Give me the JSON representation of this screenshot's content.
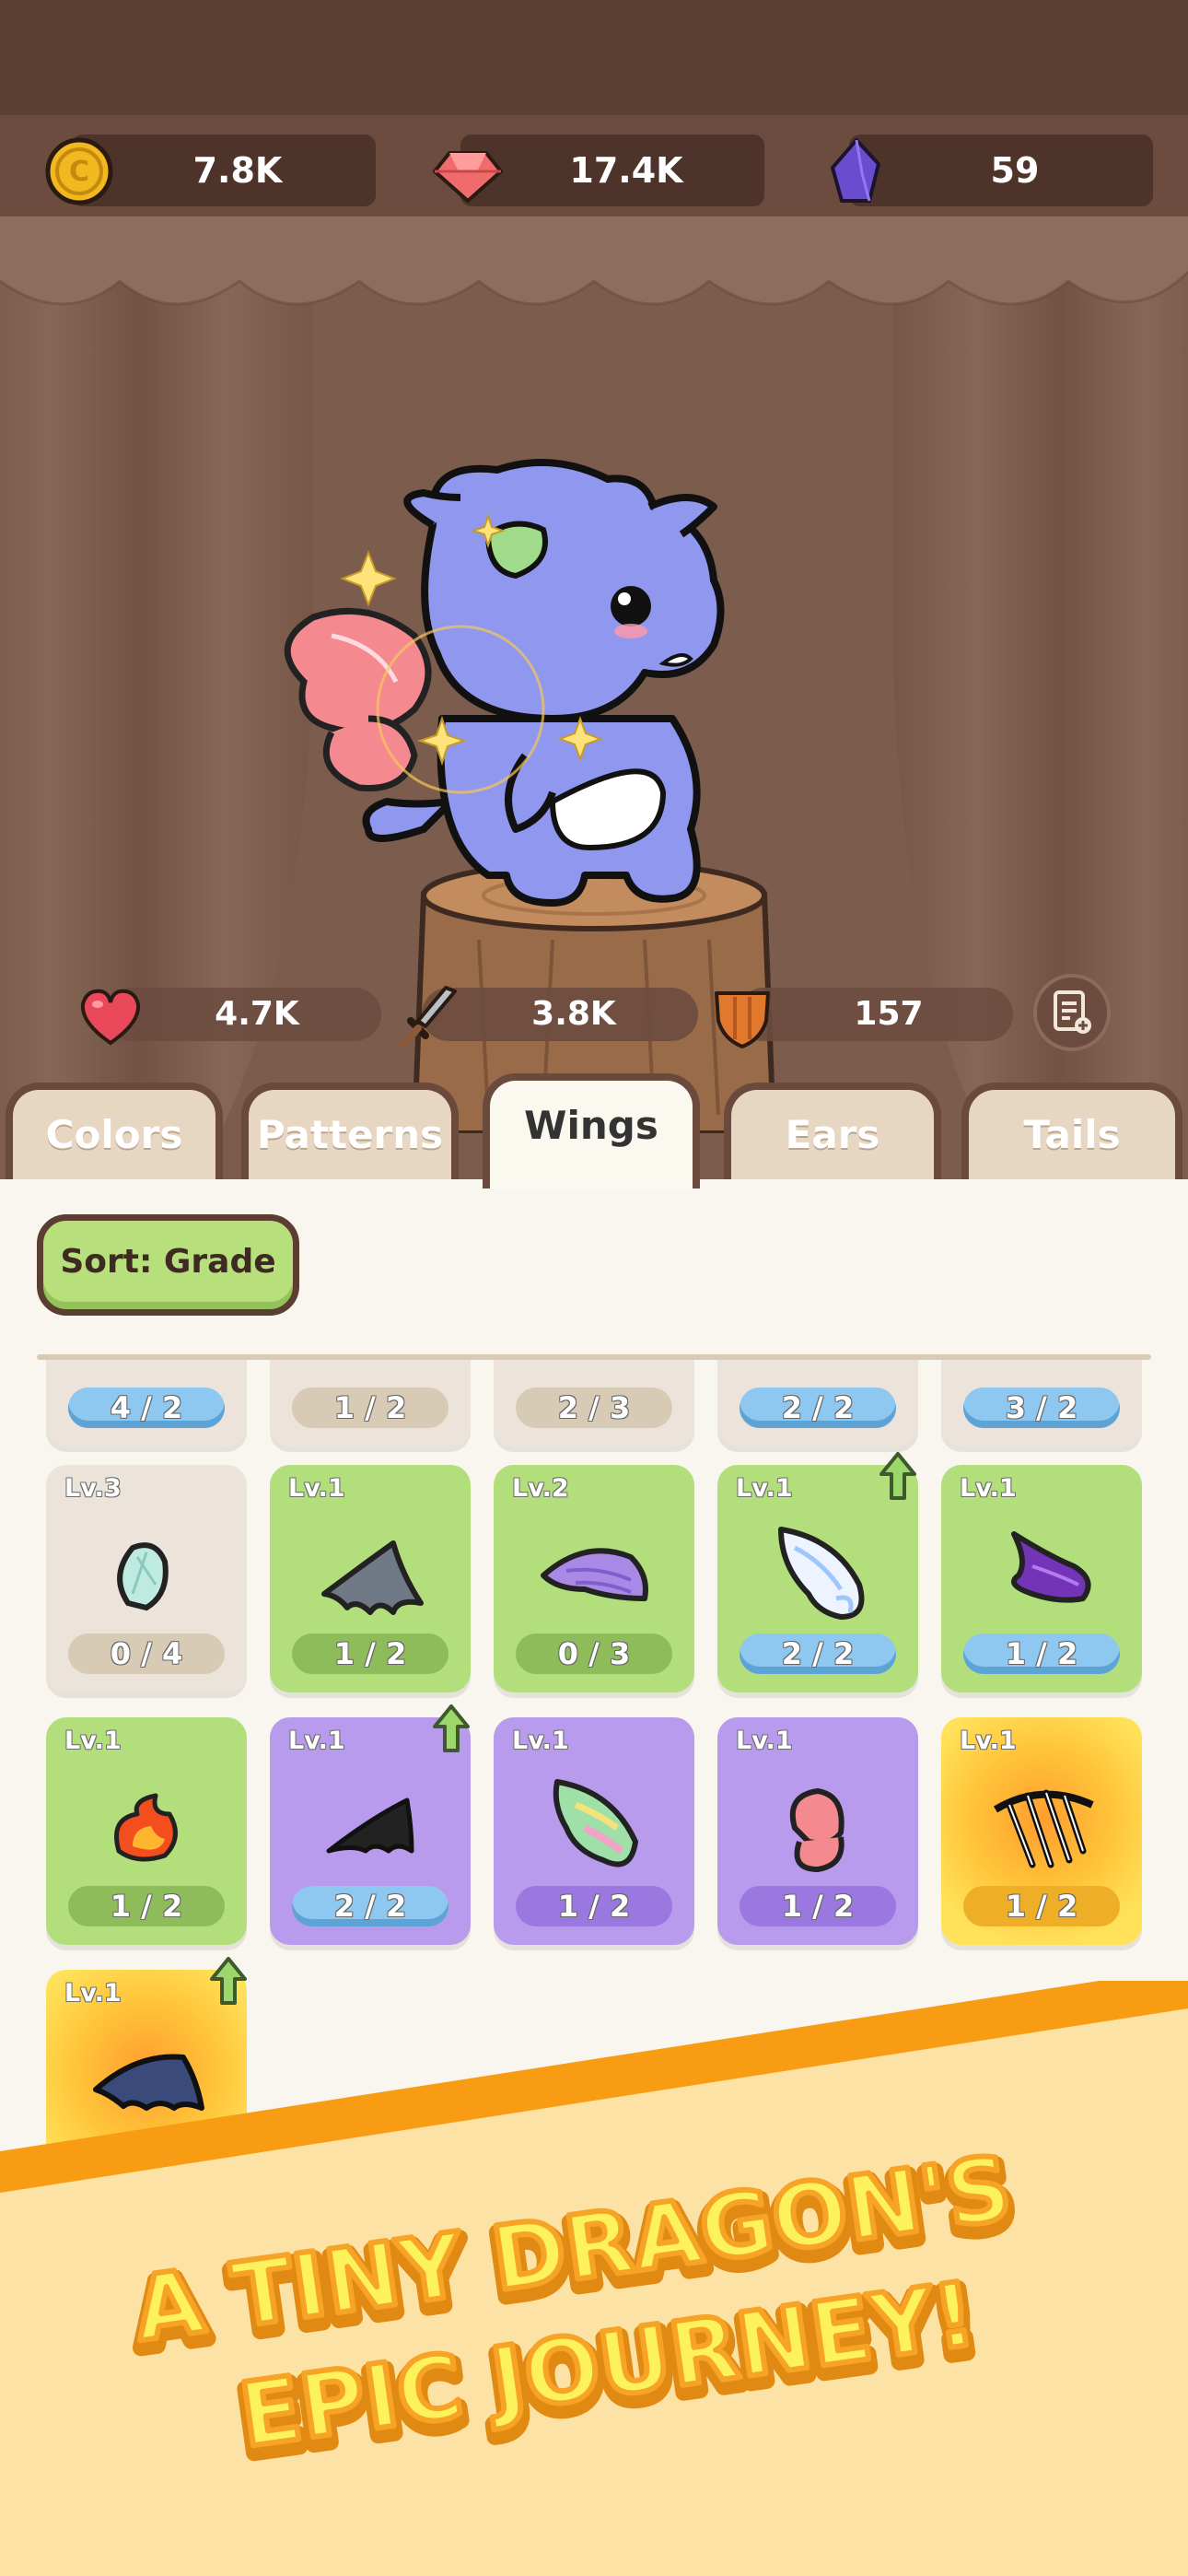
{
  "currency": {
    "coins": "7.8K",
    "gems": "17.4K",
    "crystals": "59"
  },
  "stats": {
    "health": "4.7K",
    "attack": "3.8K",
    "defense": "157"
  },
  "tabs": [
    "Colors",
    "Patterns",
    "Wings",
    "Ears",
    "Tails"
  ],
  "active_tab": "Wings",
  "sort_label": "Sort: Grade",
  "partial_row": [
    {
      "count": "4 / 2",
      "style": "full"
    },
    {
      "count": "1 / 2",
      "style": "tan"
    },
    {
      "count": "2 / 3",
      "style": "tan"
    },
    {
      "count": "2 / 2",
      "style": "full"
    },
    {
      "count": "3 / 2",
      "style": "full"
    }
  ],
  "items": [
    {
      "level": "Lv.3",
      "count": "0 / 4",
      "rarity": "gray",
      "icon": "egg-shell-wing-icon",
      "upgrade": false
    },
    {
      "level": "Lv.1",
      "count": "1 / 2",
      "rarity": "green",
      "icon": "gray-bat-wing-icon",
      "upgrade": false
    },
    {
      "level": "Lv.2",
      "count": "0 / 3",
      "rarity": "green",
      "icon": "purple-feather-wing-icon",
      "upgrade": false
    },
    {
      "level": "Lv.1",
      "count": "2 / 2",
      "rarity": "green",
      "icon": "angel-wing-icon",
      "upgrade": true
    },
    {
      "level": "Lv.1",
      "count": "1 / 2",
      "rarity": "green",
      "icon": "dark-purple-wing-icon",
      "upgrade": false
    },
    {
      "level": "Lv.1",
      "count": "1 / 2",
      "rarity": "green",
      "icon": "fire-wing-icon",
      "upgrade": false
    },
    {
      "level": "Lv.1",
      "count": "2 / 2",
      "rarity": "purple",
      "icon": "black-bat-wing-icon",
      "upgrade": true
    },
    {
      "level": "Lv.1",
      "count": "1 / 2",
      "rarity": "purple",
      "icon": "rainbow-wing-icon",
      "upgrade": false
    },
    {
      "level": "Lv.1",
      "count": "1 / 2",
      "rarity": "purple",
      "icon": "pink-butterfly-wing-icon",
      "upgrade": false
    },
    {
      "level": "Lv.1",
      "count": "1 / 2",
      "rarity": "yellow",
      "icon": "skeleton-wing-icon",
      "upgrade": false
    },
    {
      "level": "Lv.1",
      "count": "",
      "rarity": "yellow",
      "icon": "demon-bat-wing-icon",
      "upgrade": true
    }
  ],
  "banner": {
    "line1": "A TINY DRAGON'S",
    "line2": "EPIC JOURNEY!"
  },
  "colors": {
    "accent_green": "#b2df7b",
    "rare_purple": "#b99bee",
    "legend_yellow": "#ffc53a",
    "banner_orange": "#f89c14",
    "banner_text": "#fdf25c"
  }
}
